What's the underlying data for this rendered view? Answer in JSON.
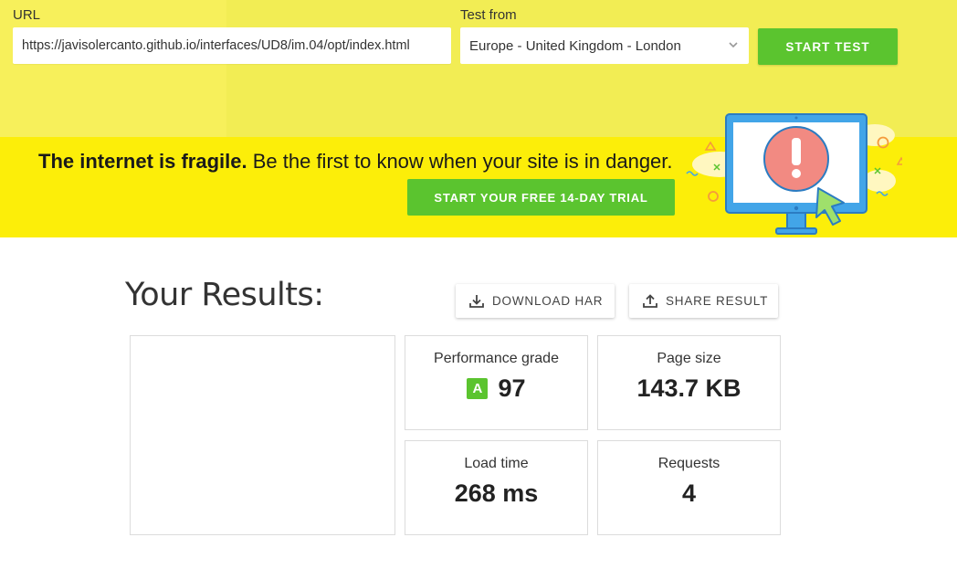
{
  "form": {
    "url_label": "URL",
    "url_value": "https://javisolercanto.github.io/interfaces/UD8/im.04/opt/index.html",
    "location_label": "Test from",
    "location_value": "Europe - United Kingdom - London",
    "start_button": "START TEST"
  },
  "banner": {
    "headline_bold": "The internet is fragile.",
    "headline_rest": " Be the first to know when your site is in danger.",
    "trial_button": "START YOUR FREE 14-DAY TRIAL"
  },
  "results": {
    "title": "Your Results:",
    "download_har": "DOWNLOAD HAR",
    "share_result": "SHARE RESULT",
    "performance": {
      "label": "Performance grade",
      "grade": "A",
      "score": "97"
    },
    "page_size": {
      "label": "Page size",
      "value": "143.7 KB"
    },
    "load_time": {
      "label": "Load time",
      "value": "268 ms"
    },
    "requests": {
      "label": "Requests",
      "value": "4"
    }
  },
  "colors": {
    "form_band": "#f2ed54",
    "banner": "#fcee09",
    "accent_green": "#5bc42f",
    "monitor_blue": "#42a5e8"
  },
  "icons": [
    "chevron-down-icon",
    "download-icon",
    "share-icon",
    "monitor-alert-icon",
    "cursor-icon"
  ]
}
